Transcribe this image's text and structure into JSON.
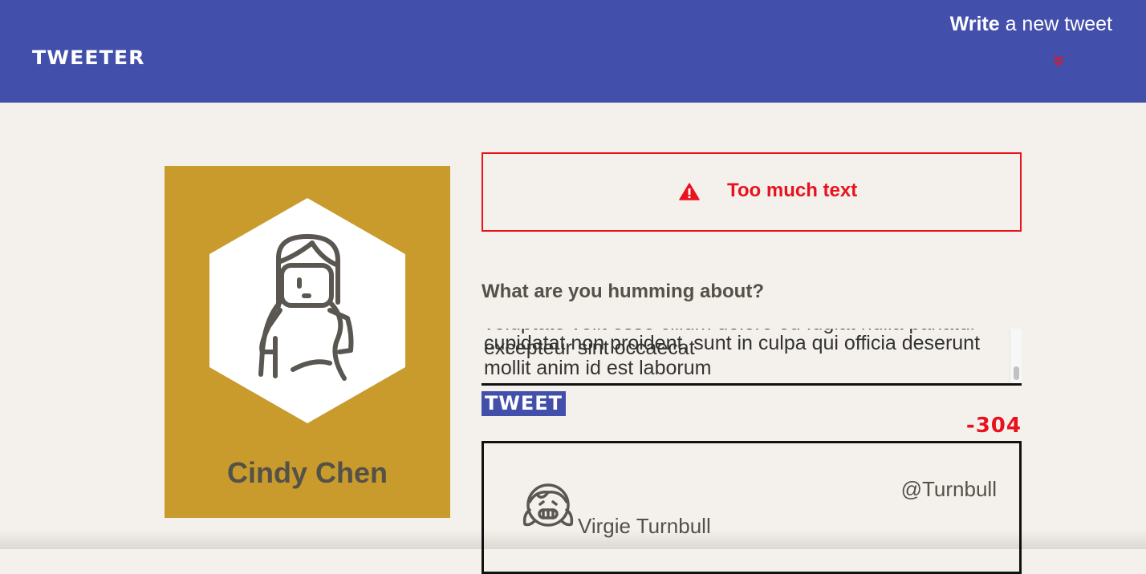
{
  "header": {
    "brand": "TWEETER",
    "compose_bold": "Write",
    "compose_rest": " a new tweet"
  },
  "profile": {
    "name": "Cindy Chen"
  },
  "error": {
    "message": "Too much text"
  },
  "composer": {
    "prompt": "What are you humming about?",
    "text_cut": "voluptate velit esse cillum dolore eu fugiat nulla pariatur excepteur sint occaecat",
    "text_line1": "cupidatat non proident, sunt in culpa qui officia deserunt",
    "text_line2": "mollit anim id est laborum",
    "button_label": "TWEET",
    "counter": "-304"
  },
  "tweet": {
    "author": "Virgie Turnbull",
    "handle": "@Turnbull"
  },
  "colors": {
    "header_bg": "#4350ab",
    "error": "#e8121f",
    "card_bg": "#c89b2c",
    "page_bg": "#f4f1ec"
  }
}
